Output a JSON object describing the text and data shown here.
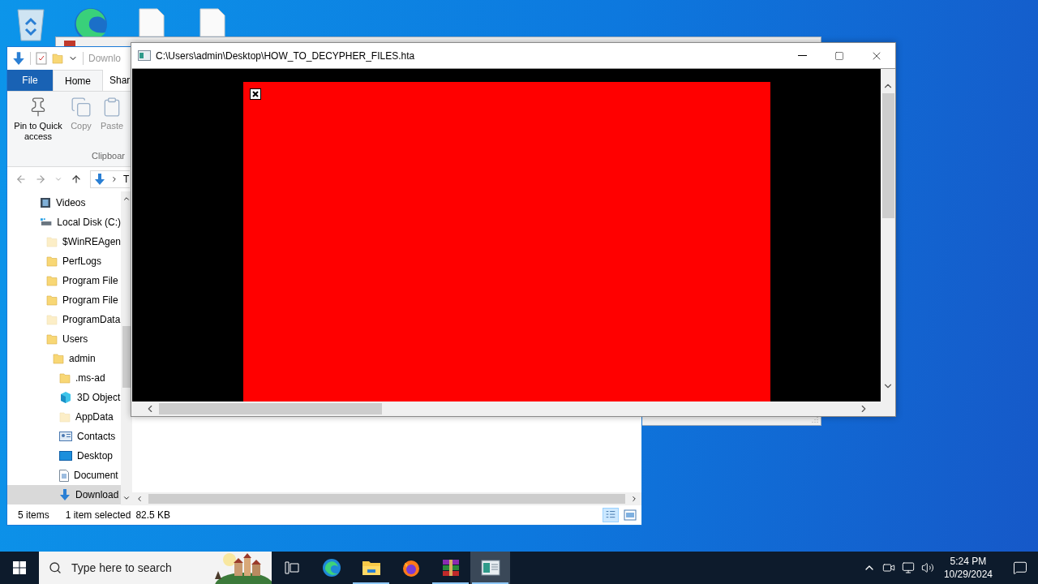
{
  "explorer": {
    "quick_access_title": "Downlo",
    "file_tab": "File",
    "tabs": [
      {
        "label": "Home",
        "selected": true
      },
      {
        "label": "Shar",
        "selected": false
      }
    ],
    "ribbon_buttons": [
      {
        "label": "Pin to Quick access",
        "disabled": false
      },
      {
        "label": "Copy",
        "disabled": true
      },
      {
        "label": "Paste",
        "disabled": true
      }
    ],
    "ribbon_group": "Clipboar",
    "address_crumb": "T",
    "nav_tree": [
      {
        "label": "Videos",
        "kind": "video",
        "selected": false
      },
      {
        "label": "Local Disk (C:)",
        "kind": "drive",
        "selected": false,
        "children": [
          {
            "label": "$WinREAgen",
            "kind": "folder",
            "hidden": true,
            "selected": false
          },
          {
            "label": "PerfLogs",
            "kind": "folder",
            "hidden": false,
            "selected": false
          },
          {
            "label": "Program File",
            "kind": "folder",
            "hidden": false,
            "selected": false
          },
          {
            "label": "Program File",
            "kind": "folder",
            "hidden": false,
            "selected": false
          },
          {
            "label": "ProgramData",
            "kind": "folder",
            "hidden": true,
            "selected": false
          },
          {
            "label": "Users",
            "kind": "folder",
            "hidden": false,
            "selected": false,
            "children": [
              {
                "label": "admin",
                "kind": "folder",
                "hidden": false,
                "selected": false,
                "children": [
                  {
                    "label": ".ms-ad",
                    "kind": "folder",
                    "hidden": false,
                    "selected": false
                  },
                  {
                    "label": "3D Object",
                    "kind": "cube",
                    "selected": false
                  },
                  {
                    "label": "AppData",
                    "kind": "folder",
                    "hidden": true,
                    "selected": false
                  },
                  {
                    "label": "Contacts",
                    "kind": "contacts",
                    "selected": false
                  },
                  {
                    "label": "Desktop",
                    "kind": "desktop",
                    "selected": false
                  },
                  {
                    "label": "Document",
                    "kind": "document",
                    "selected": false
                  },
                  {
                    "label": "Download",
                    "kind": "download",
                    "selected": true
                  }
                ]
              }
            ]
          }
        ]
      }
    ],
    "status": {
      "count": "5 items",
      "selection": "1 item selected",
      "size": "82.5 KB"
    }
  },
  "hta_window": {
    "title": "C:\\Users\\admin\\Desktop\\HOW_TO_DECYPHER_FILES.hta"
  },
  "taskbar": {
    "search_placeholder": "Type here to search",
    "apps": [
      {
        "running": false,
        "selected": false
      },
      {
        "running": true,
        "selected": false
      },
      {
        "running": false,
        "selected": false
      },
      {
        "running": true,
        "selected": false
      },
      {
        "running": true,
        "selected": true
      }
    ],
    "time": "5:24 PM",
    "date": "10/29/2024"
  }
}
